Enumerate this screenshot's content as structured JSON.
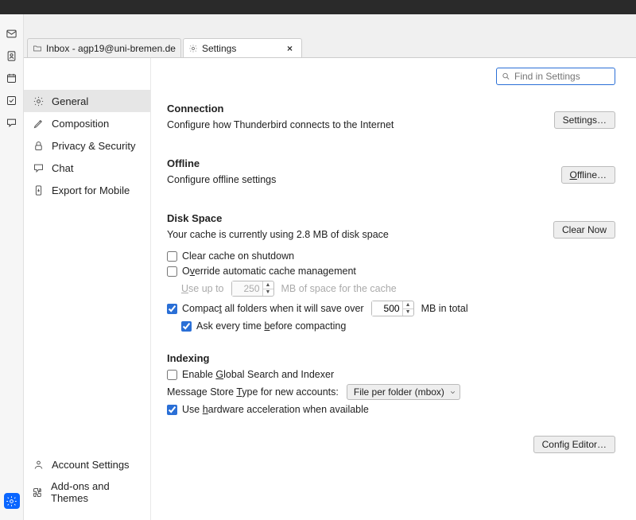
{
  "tabs": {
    "inbox": {
      "label": "Inbox - agp19@uni-bremen.de"
    },
    "settings": {
      "label": "Settings"
    }
  },
  "search": {
    "placeholder": "Find in Settings"
  },
  "sidebar": {
    "general": "General",
    "composition": "Composition",
    "privacy": "Privacy & Security",
    "chat": "Chat",
    "export": "Export for Mobile",
    "account": "Account Settings",
    "addons": "Add-ons and Themes"
  },
  "connection": {
    "title": "Connection",
    "desc": "Configure how Thunderbird connects to the Internet",
    "button": "Settings…"
  },
  "offline": {
    "title": "Offline",
    "desc": "Configure offline settings",
    "button": "Offline…"
  },
  "diskspace": {
    "title": "Disk Space",
    "desc": "Your cache is currently using 2.8 MB of disk space",
    "clear_now": "Clear Now",
    "clear_cache": "Clear cache on shutdown",
    "override_pre": "O",
    "override_u": "v",
    "override_post": "erride automatic cache management",
    "useupto_u": "U",
    "useupto_post": "se up to",
    "useupto_value": "250",
    "useupto_suffix": "MB of space for the cache",
    "compact_pre": "Compac",
    "compact_u": "t",
    "compact_post": " all folders when it will save over",
    "compact_value": "500",
    "compact_suffix": "MB in total",
    "askevery_pre": "Ask every time ",
    "askevery_u": "b",
    "askevery_post": "efore compacting"
  },
  "indexing": {
    "title": "Indexing",
    "enable_pre": "Enable ",
    "enable_u": "G",
    "enable_post": "lobal Search and Indexer",
    "store_pre": "Message Store ",
    "store_u": "T",
    "store_post": "ype for new accounts:",
    "store_value": "File per folder (mbox)",
    "hw_pre": "Use ",
    "hw_u": "h",
    "hw_post": "ardware acceleration when available"
  },
  "config_editor": "Config Editor…"
}
